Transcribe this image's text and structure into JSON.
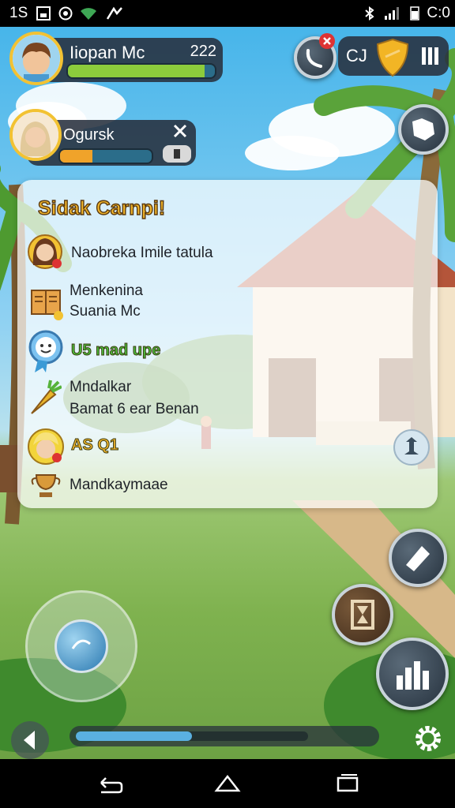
{
  "status_bar": {
    "time": "1S",
    "clock": "C:0"
  },
  "player": {
    "name": "Iiopan Mc",
    "level": "222",
    "health_fraction": 0.93
  },
  "companion": {
    "name": "Ogursk",
    "health_fraction": 0.35
  },
  "top_right": {
    "label": "CJ"
  },
  "panel": {
    "title": "Sidak Carnpi!",
    "rows": [
      {
        "icon": "girl-avatar-icon",
        "text": "Naobreka Imile tatula"
      },
      {
        "icon": "book-icon",
        "line1": "Menkenina",
        "line2": "Suania Mc"
      },
      {
        "icon": "smiley-badge-icon",
        "text": "U5 mad upe"
      },
      {
        "icon": "carrot-icon",
        "line1": "Mndalkar",
        "line2": "Bamat 6 ear Benan"
      },
      {
        "icon": "blonde-avatar-icon",
        "text": "AS Q1"
      },
      {
        "icon": "trophy-icon",
        "text": "Mandkaymaae"
      }
    ]
  },
  "bottom": {
    "progress_fraction": 0.5
  },
  "colors": {
    "accent_yellow": "#f2c233",
    "health_green": "#8ccc3c",
    "xp_blue": "#4aa6dd",
    "hud_dark": "#28303e"
  }
}
